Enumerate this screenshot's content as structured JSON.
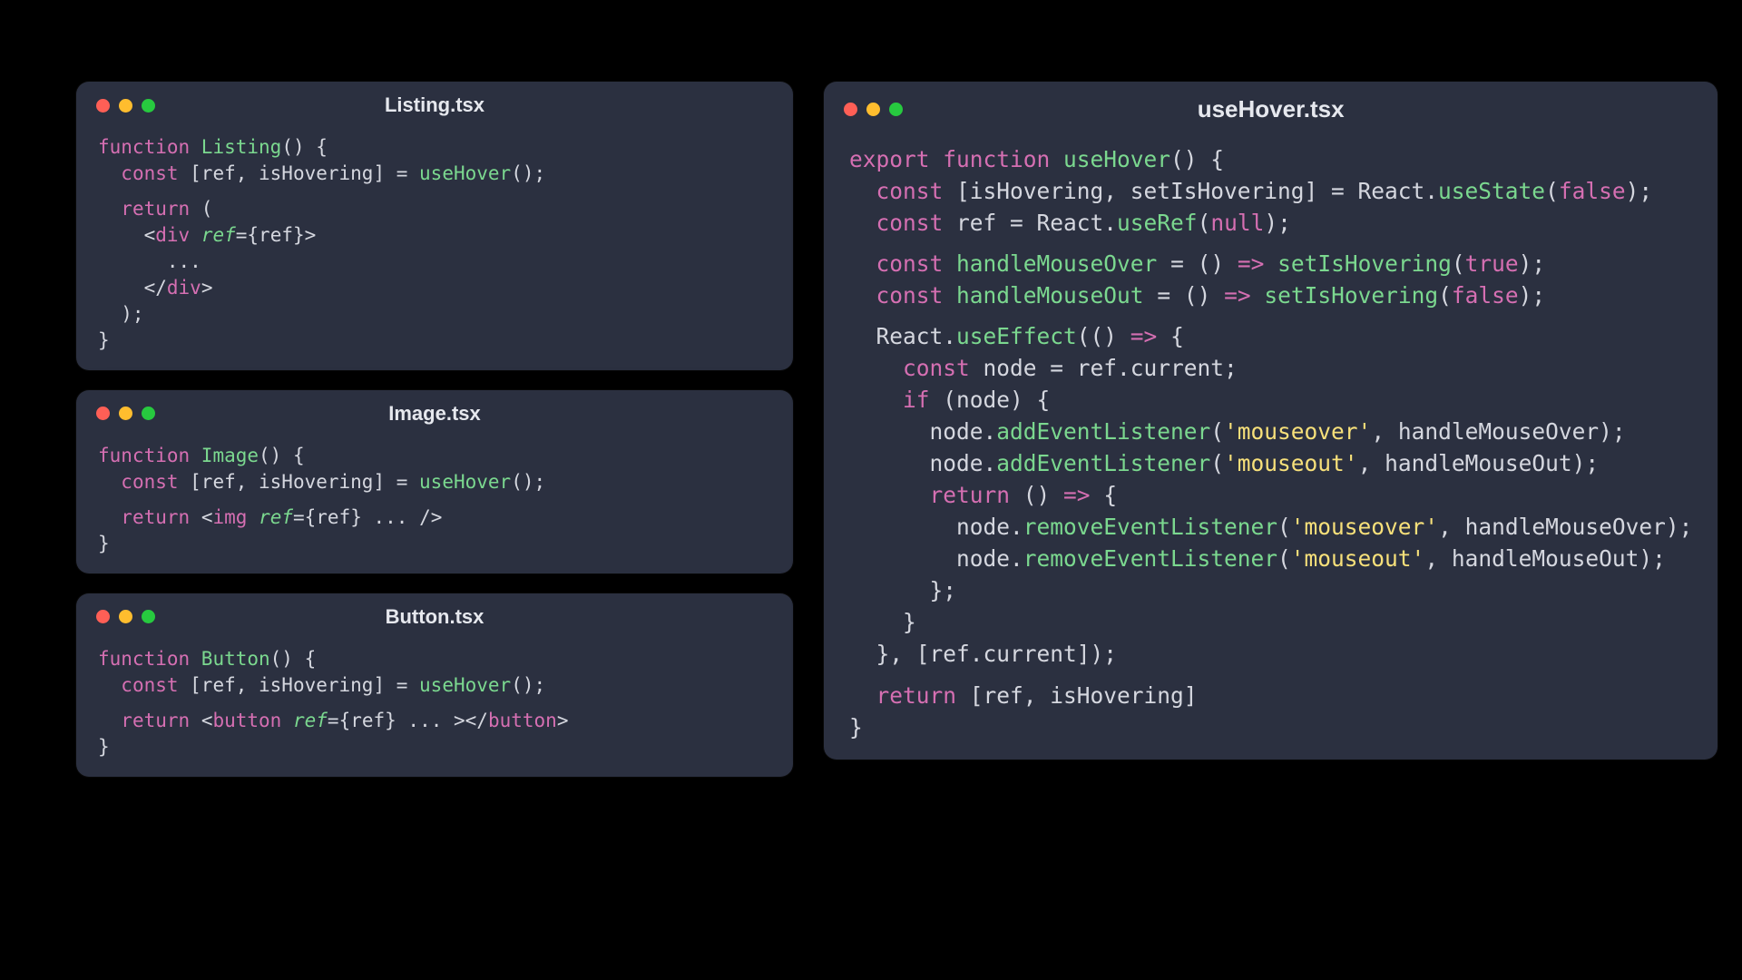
{
  "windows": {
    "listing": {
      "title": "Listing.tsx",
      "tokens": [
        [
          [
            "k",
            "function "
          ],
          [
            "fn",
            "Listing"
          ],
          [
            "id",
            "() {"
          ]
        ],
        [
          [
            "id",
            "  "
          ],
          [
            "k",
            "const"
          ],
          [
            "id",
            " [ref, isHovering] = "
          ],
          [
            "fn",
            "useHover"
          ],
          [
            "id",
            "();"
          ]
        ],
        "gap",
        [
          [
            "id",
            "  "
          ],
          [
            "k",
            "return"
          ],
          [
            "id",
            " ("
          ]
        ],
        [
          [
            "id",
            "    "
          ],
          [
            "br",
            "<"
          ],
          [
            "tg",
            "div"
          ],
          [
            "id",
            " "
          ],
          [
            "at",
            "ref"
          ],
          [
            "id",
            "={ref}"
          ],
          [
            "br",
            ">"
          ]
        ],
        [
          [
            "id",
            "      ..."
          ]
        ],
        [
          [
            "id",
            "    "
          ],
          [
            "br",
            "</"
          ],
          [
            "tg",
            "div"
          ],
          [
            "br",
            ">"
          ]
        ],
        [
          [
            "id",
            "  );"
          ]
        ],
        [
          [
            "id",
            "}"
          ]
        ]
      ]
    },
    "image": {
      "title": "Image.tsx",
      "tokens": [
        [
          [
            "k",
            "function "
          ],
          [
            "fn",
            "Image"
          ],
          [
            "id",
            "() {"
          ]
        ],
        [
          [
            "id",
            "  "
          ],
          [
            "k",
            "const"
          ],
          [
            "id",
            " [ref, isHovering] = "
          ],
          [
            "fn",
            "useHover"
          ],
          [
            "id",
            "();"
          ]
        ],
        "gap",
        [
          [
            "id",
            "  "
          ],
          [
            "k",
            "return"
          ],
          [
            "id",
            " "
          ],
          [
            "br",
            "<"
          ],
          [
            "tg",
            "img"
          ],
          [
            "id",
            " "
          ],
          [
            "at",
            "ref"
          ],
          [
            "id",
            "={ref} ... "
          ],
          [
            "br",
            "/>"
          ]
        ],
        [
          [
            "id",
            "}"
          ]
        ]
      ]
    },
    "button": {
      "title": "Button.tsx",
      "tokens": [
        [
          [
            "k",
            "function "
          ],
          [
            "fn",
            "Button"
          ],
          [
            "id",
            "() {"
          ]
        ],
        [
          [
            "id",
            "  "
          ],
          [
            "k",
            "const"
          ],
          [
            "id",
            " [ref, isHovering] = "
          ],
          [
            "fn",
            "useHover"
          ],
          [
            "id",
            "();"
          ]
        ],
        "gap",
        [
          [
            "id",
            "  "
          ],
          [
            "k",
            "return"
          ],
          [
            "id",
            " "
          ],
          [
            "br",
            "<"
          ],
          [
            "tg",
            "button"
          ],
          [
            "id",
            " "
          ],
          [
            "at",
            "ref"
          ],
          [
            "id",
            "={ref} ... "
          ],
          [
            "br",
            ">"
          ],
          [
            "br",
            "</"
          ],
          [
            "tg",
            "button"
          ],
          [
            "br",
            ">"
          ]
        ],
        [
          [
            "id",
            "}"
          ]
        ]
      ]
    },
    "usehover": {
      "title": "useHover.tsx",
      "tokens": [
        [
          [
            "k",
            "export function "
          ],
          [
            "fn",
            "useHover"
          ],
          [
            "id",
            "() {"
          ]
        ],
        [
          [
            "id",
            "  "
          ],
          [
            "k",
            "const"
          ],
          [
            "id",
            " [isHovering, setIsHovering] = React."
          ],
          [
            "fn",
            "useState"
          ],
          [
            "id",
            "("
          ],
          [
            "lit",
            "false"
          ],
          [
            "id",
            ");"
          ]
        ],
        [
          [
            "id",
            "  "
          ],
          [
            "k",
            "const"
          ],
          [
            "id",
            " ref = React."
          ],
          [
            "fn",
            "useRef"
          ],
          [
            "id",
            "("
          ],
          [
            "lit",
            "null"
          ],
          [
            "id",
            ");"
          ]
        ],
        "gap",
        [
          [
            "id",
            "  "
          ],
          [
            "k",
            "const"
          ],
          [
            "id",
            " "
          ],
          [
            "fn",
            "handleMouseOver"
          ],
          [
            "id",
            " = () "
          ],
          [
            "k",
            "=>"
          ],
          [
            "id",
            " "
          ],
          [
            "fn",
            "setIsHovering"
          ],
          [
            "id",
            "("
          ],
          [
            "lit",
            "true"
          ],
          [
            "id",
            ");"
          ]
        ],
        [
          [
            "id",
            "  "
          ],
          [
            "k",
            "const"
          ],
          [
            "id",
            " "
          ],
          [
            "fn",
            "handleMouseOut"
          ],
          [
            "id",
            " = () "
          ],
          [
            "k",
            "=>"
          ],
          [
            "id",
            " "
          ],
          [
            "fn",
            "setIsHovering"
          ],
          [
            "id",
            "("
          ],
          [
            "lit",
            "false"
          ],
          [
            "id",
            ");"
          ]
        ],
        "gap",
        [
          [
            "id",
            "  React."
          ],
          [
            "fn",
            "useEffect"
          ],
          [
            "id",
            "(() "
          ],
          [
            "k",
            "=>"
          ],
          [
            "id",
            " {"
          ]
        ],
        [
          [
            "id",
            "    "
          ],
          [
            "k",
            "const"
          ],
          [
            "id",
            " node = ref.current;"
          ]
        ],
        [
          [
            "id",
            "    "
          ],
          [
            "k",
            "if"
          ],
          [
            "id",
            " (node) {"
          ]
        ],
        [
          [
            "id",
            "      node."
          ],
          [
            "fn",
            "addEventListener"
          ],
          [
            "id",
            "("
          ],
          [
            "str",
            "'mouseover'"
          ],
          [
            "id",
            ", handleMouseOver);"
          ]
        ],
        [
          [
            "id",
            "      node."
          ],
          [
            "fn",
            "addEventListener"
          ],
          [
            "id",
            "("
          ],
          [
            "str",
            "'mouseout'"
          ],
          [
            "id",
            ", handleMouseOut);"
          ]
        ],
        [
          [
            "id",
            "      "
          ],
          [
            "k",
            "return"
          ],
          [
            "id",
            " () "
          ],
          [
            "k",
            "=>"
          ],
          [
            "id",
            " {"
          ]
        ],
        [
          [
            "id",
            "        node."
          ],
          [
            "fn",
            "removeEventListener"
          ],
          [
            "id",
            "("
          ],
          [
            "str",
            "'mouseover'"
          ],
          [
            "id",
            ", handleMouseOver);"
          ]
        ],
        [
          [
            "id",
            "        node."
          ],
          [
            "fn",
            "removeEventListener"
          ],
          [
            "id",
            "("
          ],
          [
            "str",
            "'mouseout'"
          ],
          [
            "id",
            ", handleMouseOut);"
          ]
        ],
        [
          [
            "id",
            "      };"
          ]
        ],
        [
          [
            "id",
            "    }"
          ]
        ],
        [
          [
            "id",
            "  }, [ref.current]);"
          ]
        ],
        "gap",
        [
          [
            "id",
            "  "
          ],
          [
            "k",
            "return"
          ],
          [
            "id",
            " [ref, isHovering]"
          ]
        ],
        [
          [
            "id",
            "}"
          ]
        ]
      ]
    }
  }
}
